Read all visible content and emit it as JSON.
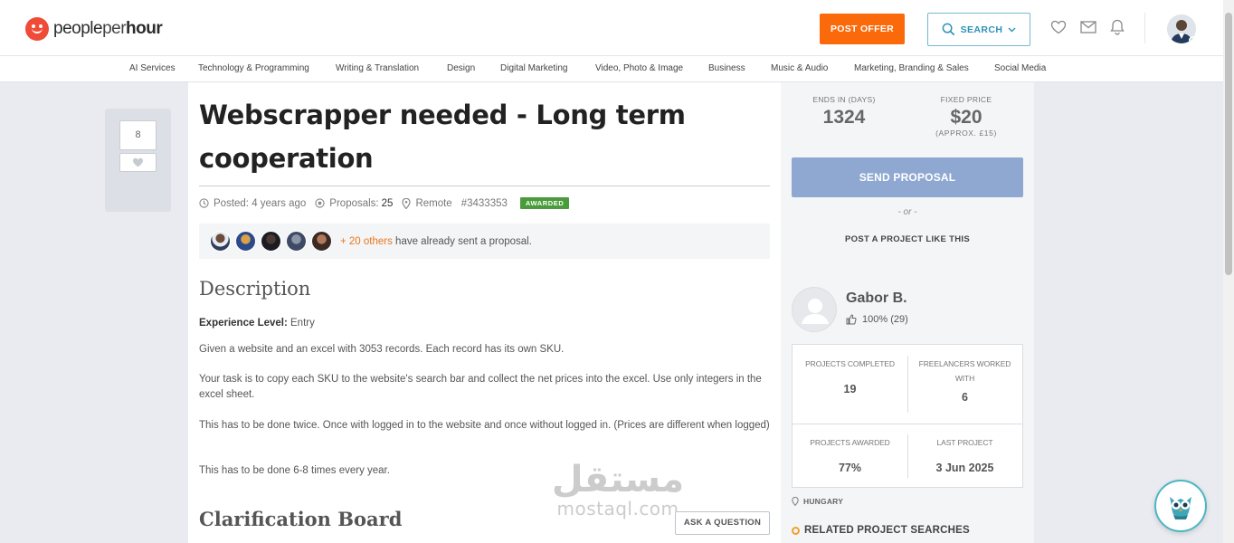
{
  "header": {
    "logo_people": "people",
    "logo_per": "per",
    "logo_hour": "hour",
    "post_offer": "POST OFFER",
    "search": "SEARCH"
  },
  "categories": [
    "AI Services",
    "Technology & Programming",
    "Writing & Translation",
    "Design",
    "Digital Marketing",
    "Video, Photo & Image",
    "Business",
    "Music & Audio",
    "Marketing, Branding & Sales",
    "Social Media"
  ],
  "vote": {
    "count": "8"
  },
  "project": {
    "title": "Webscrapper needed - Long term cooperation",
    "posted": "Posted: 4 years ago",
    "proposals_label": "Proposals:",
    "proposals_count": "25",
    "location": "Remote",
    "id": "#3433353",
    "status": "AWARDED",
    "others_link": "+ 20 others",
    "others_text": " have already sent a proposal."
  },
  "description": {
    "heading": "Description",
    "exp_label": "Experience Level:",
    "exp_value": " Entry",
    "p1": "Given a website and an excel with 3053 records. Each record has its own SKU.",
    "p2": "Your task is to copy each SKU to the website's search bar and collect the net prices into the excel. Use only integers in the excel sheet.",
    "p3": "This has to be done twice. Once with logged in to the website and once without logged in. (Prices are different when logged)",
    "p4": "This has to be done 6-8 times every year."
  },
  "clarification": {
    "heading": "Clarification Board",
    "ask": "ASK A QUESTION"
  },
  "watermark": {
    "ar": "مستقل",
    "en": "mostaql.com"
  },
  "sidebar": {
    "ends_label": "ENDS IN (DAYS)",
    "ends_value": "1324",
    "price_label": "FIXED PRICE",
    "price_value": "$20",
    "price_sub": "(APPROX. £15)",
    "send": "SEND PROPOSAL",
    "or": "- or -",
    "post_like": "POST A PROJECT LIKE THIS",
    "buyer_name": "Gabor B.",
    "buyer_rating": "100% (29)",
    "stats": [
      {
        "label": "PROJECTS COMPLETED",
        "value": "19"
      },
      {
        "label": "FREELANCERS WORKED WITH",
        "value": "6"
      },
      {
        "label": "PROJECTS AWARDED",
        "value": "77%"
      },
      {
        "label": "LAST PROJECT",
        "value": "3 Jun 2025"
      }
    ],
    "country": "HUNGARY",
    "related": "RELATED PROJECT SEARCHES"
  },
  "colors": {
    "accent_orange": "#fa6a0a",
    "search_blue": "#2d92b6",
    "send_button": "#8fa8d1",
    "awarded_green": "#4a9b3b"
  }
}
